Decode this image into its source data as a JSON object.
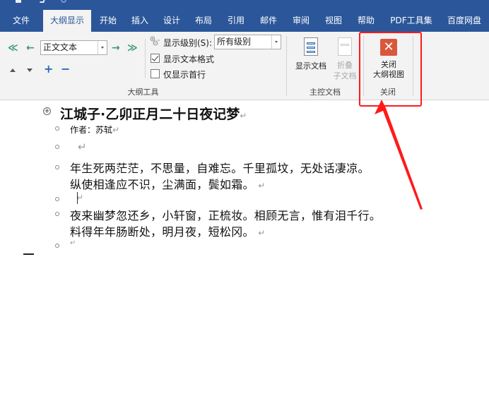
{
  "quick_access": {
    "icons": [
      "save-icon",
      "undo-icon",
      "redo-icon"
    ]
  },
  "tabs": [
    {
      "label": "文件",
      "active": false
    },
    {
      "label": "大纲显示",
      "active": true
    },
    {
      "label": "开始",
      "active": false
    },
    {
      "label": "插入",
      "active": false
    },
    {
      "label": "设计",
      "active": false
    },
    {
      "label": "布局",
      "active": false
    },
    {
      "label": "引用",
      "active": false
    },
    {
      "label": "邮件",
      "active": false
    },
    {
      "label": "审阅",
      "active": false
    },
    {
      "label": "视图",
      "active": false
    },
    {
      "label": "帮助",
      "active": false
    },
    {
      "label": "PDF工具集",
      "active": false
    },
    {
      "label": "百度网盘",
      "active": false
    }
  ],
  "outline_tools": {
    "group_label": "大纲工具",
    "promote_to_heading1": "≪",
    "promote": "←",
    "demote": "→",
    "demote_to_body": "≫",
    "level_value": "正文文本",
    "show_level_label": "显示级别(S):",
    "show_level_value": "所有级别",
    "show_text_formatting_label": "显示文本格式",
    "show_text_formatting_checked": true,
    "show_first_line_only_label": "仅显示首行",
    "show_first_line_only_checked": false,
    "move_up": "▲",
    "move_down": "▼",
    "expand": "+",
    "collapse": "−"
  },
  "master_document": {
    "group_label": "主控文档",
    "show_document_label": "显示文档",
    "collapse_subdocs_line1": "折叠",
    "collapse_subdocs_line2": "子文档"
  },
  "close_group": {
    "group_label": "关闭",
    "close_outline_line1": "关闭",
    "close_outline_line2": "大纲视图",
    "close_icon_glyph": "✕",
    "accent_color": "#d9583b"
  },
  "annotation": {
    "highlight_color": "#ff1a1a"
  },
  "document": {
    "title": "江城子·乙卯正月二十日夜记梦",
    "author": "作者：苏轼",
    "para1_line1": "年生死两茫茫，不思量，自难忘。千里孤坟，无处话凄凉。",
    "para1_line2": "纵使相逢应不识，尘满面，鬓如霜。",
    "para2_line1": "夜来幽梦忽还乡，小轩窗，正梳妆。相顾无言，惟有泪千行。",
    "para2_line2": "料得年年肠断处，明月夜，短松冈。",
    "paragraph_mark": "↵"
  }
}
